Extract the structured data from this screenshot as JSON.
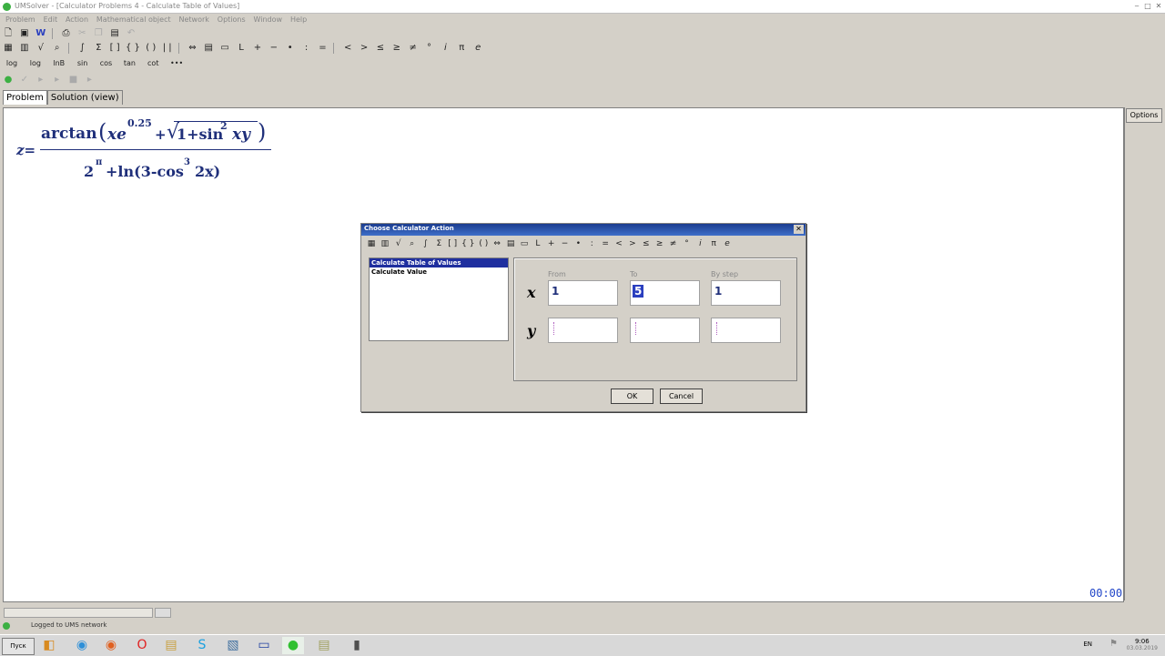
{
  "window": {
    "title": "UMSolver - [Calculator Problems 4 - Calculate Table of Values]",
    "controls": [
      "‒",
      "□",
      "✕"
    ]
  },
  "menu": [
    "Problem",
    "Edit",
    "Action",
    "Mathematical object",
    "Network",
    "Options",
    "Window",
    "Help"
  ],
  "toolbar3": [
    "log",
    "log",
    "lnB",
    "sin",
    "cos",
    "tan",
    "cot",
    "•••"
  ],
  "tabs": [
    {
      "label": "Problem",
      "active": true
    },
    {
      "label": "Solution (view)",
      "active": false
    }
  ],
  "options_button": "Options",
  "formula": {
    "lhs": "z=",
    "numerator": {
      "func": "arctan",
      "x": "xe",
      "exp1": "0.25",
      "plus": "+",
      "sqrt_body": "1+sin",
      "exp2": "2",
      "xy": "xy"
    },
    "denominator": {
      "base": "2",
      "exp": "π",
      "rest": "+ln(3-cos",
      "exp2": "3",
      "tail": "2x)"
    }
  },
  "dialog": {
    "title": "Choose Calculator Action",
    "close": "✕",
    "actions": [
      {
        "label": "Calculate Table of Values",
        "selected": true
      },
      {
        "label": "Calculate Value",
        "selected": false
      }
    ],
    "columns": [
      "From",
      "To",
      "By step"
    ],
    "rows": [
      {
        "var": "x",
        "from": "1",
        "to": "5",
        "step": "1"
      },
      {
        "var": "y",
        "from": "",
        "to": "",
        "step": ""
      }
    ],
    "ok": "OK",
    "cancel": "Cancel"
  },
  "status": {
    "message": "Logged to UMS network",
    "timer": "00:00"
  },
  "taskbar": {
    "start": "Пуск",
    "tray_lang": "EN",
    "tray_time": "9:06",
    "tray_date": "03.03.2019"
  }
}
